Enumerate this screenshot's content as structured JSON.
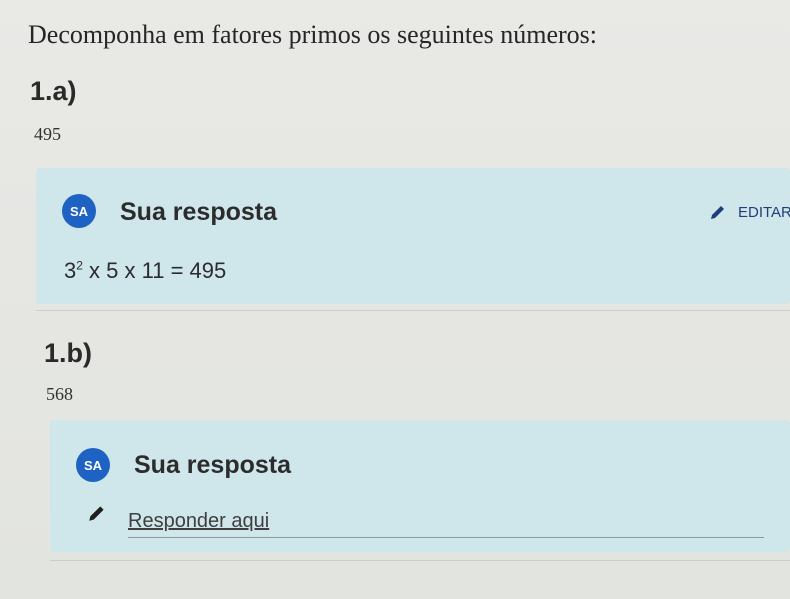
{
  "instruction": "Decomponha em fatores primos os seguintes números:",
  "questions": [
    {
      "label": "1.a)",
      "number": "495",
      "card": {
        "avatar": "SA",
        "title": "Sua resposta",
        "edit_label": "EDITAR",
        "answer": {
          "base": "3",
          "exponent": "2",
          "rest": " x 5 x 11 = 495"
        }
      }
    },
    {
      "label": "1.b)",
      "number": "568",
      "card": {
        "avatar": "SA",
        "title": "Sua resposta",
        "placeholder": "Responder aqui"
      }
    }
  ],
  "icons": {
    "edit": "pencil-icon",
    "reply": "pencil-icon"
  },
  "colors": {
    "avatar_bg": "#1e63c4",
    "card_bg": "#cfe6ea",
    "edit_text": "#1f3f7a"
  }
}
